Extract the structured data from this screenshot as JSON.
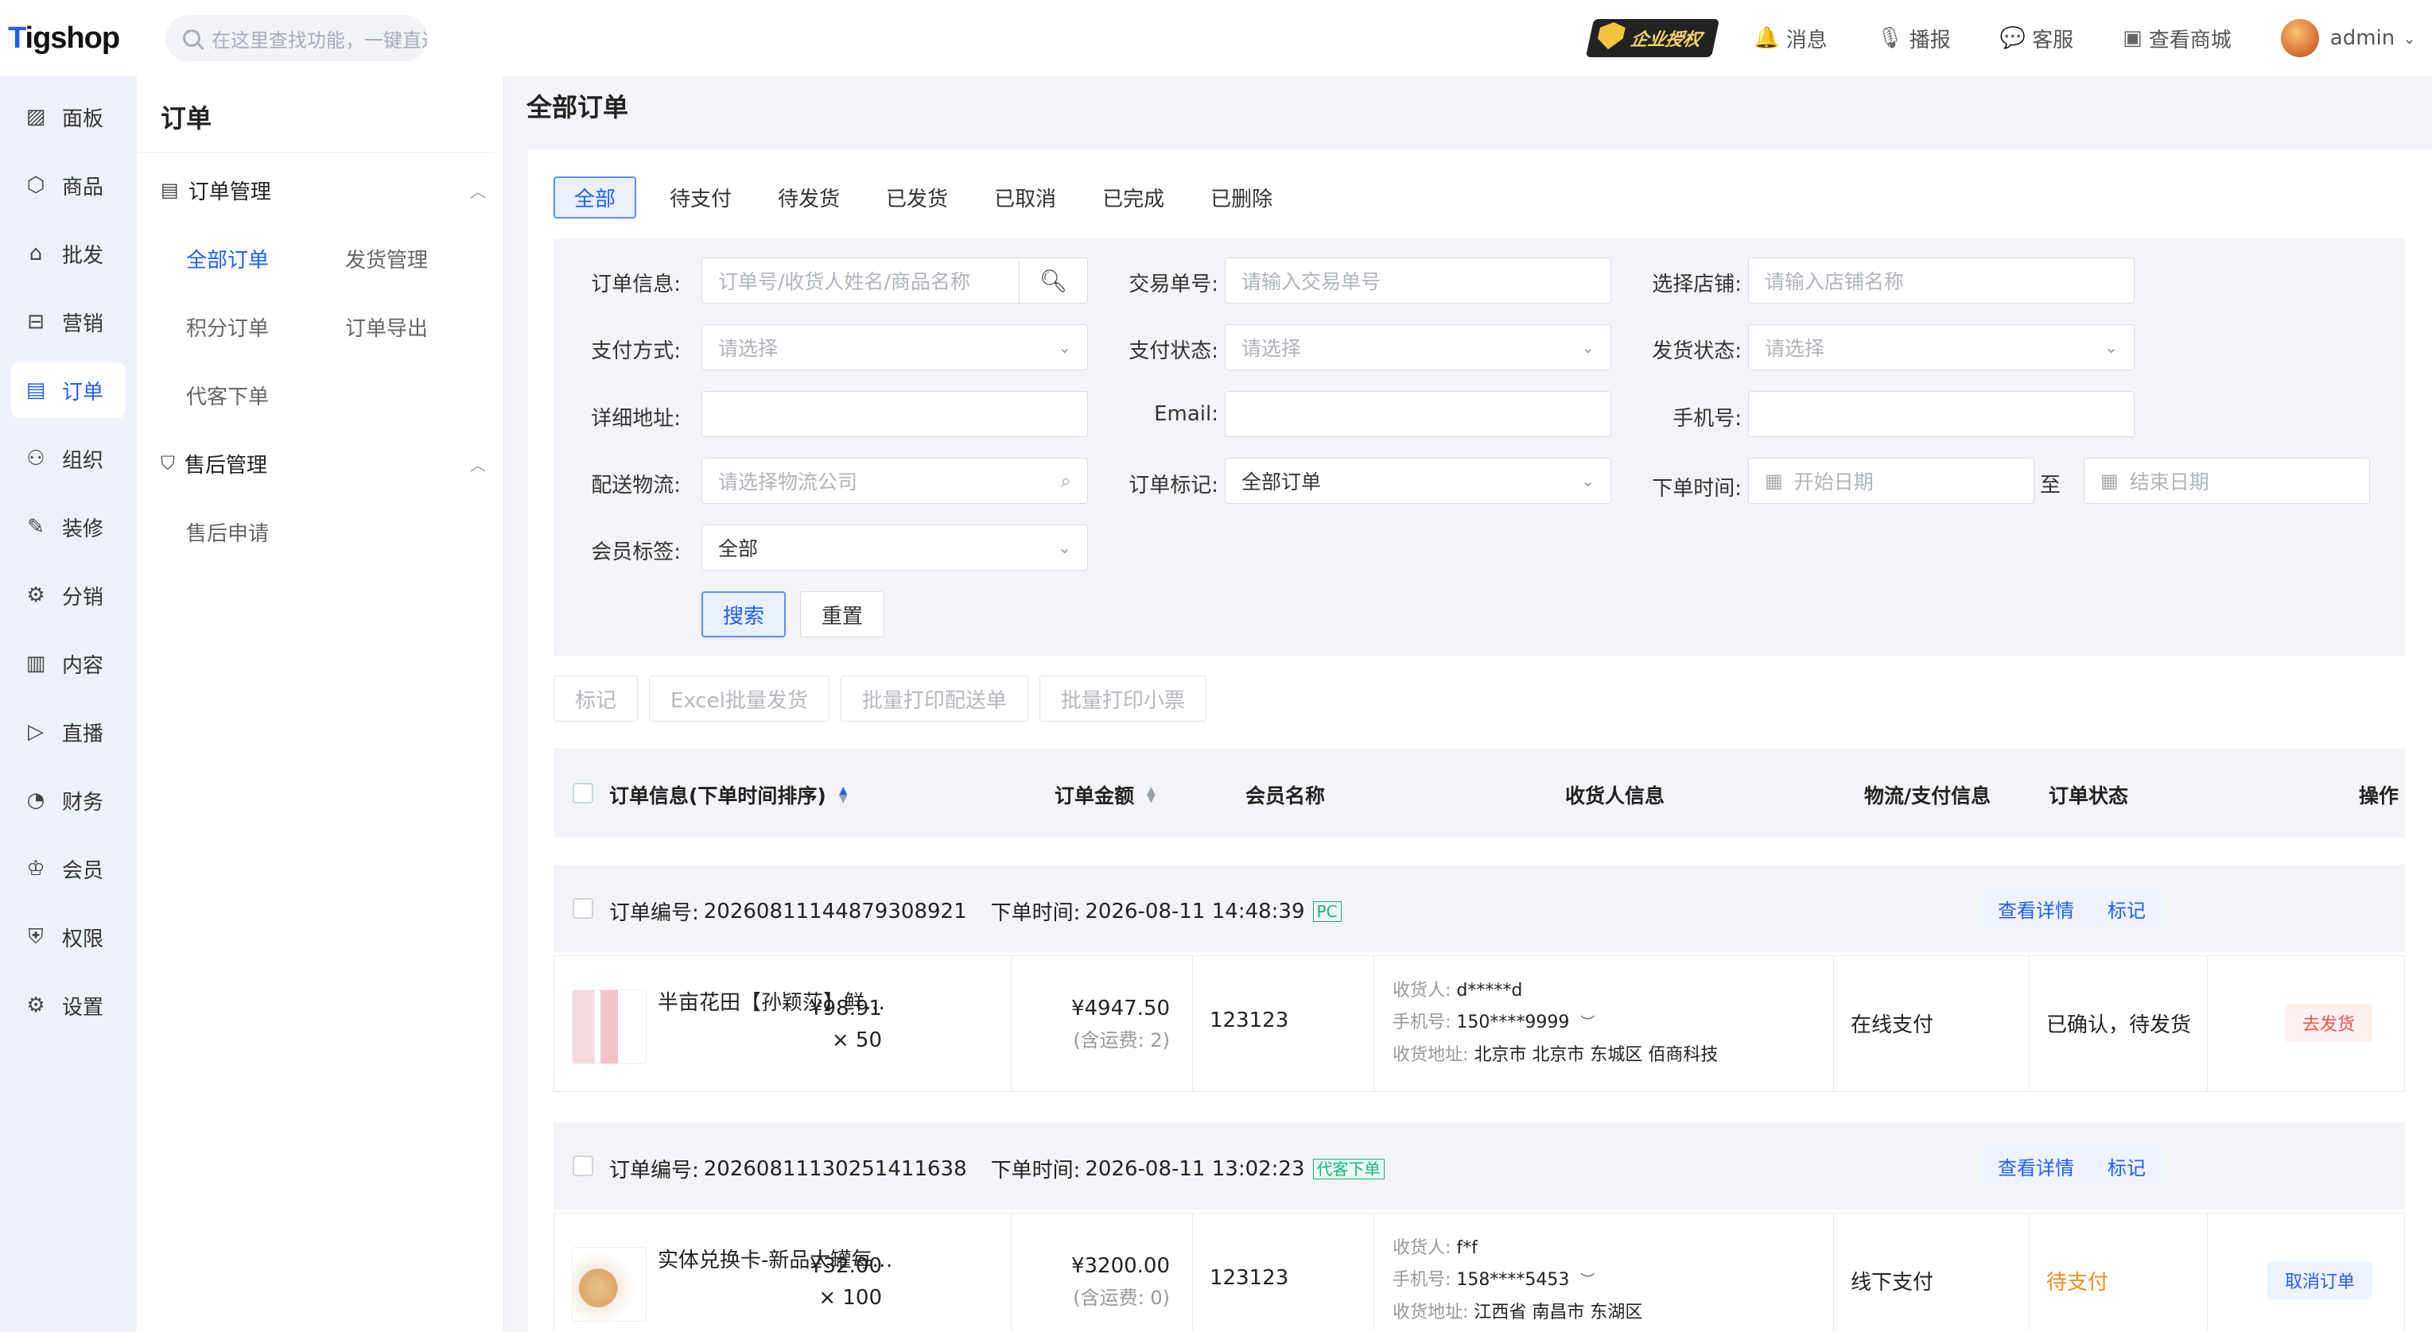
{
  "app": {
    "logo": "Tigshop",
    "logo_first": "T",
    "logo_rest": "igshop"
  },
  "search": {
    "placeholder": "在这里查找功能，一键直达"
  },
  "top": {
    "badge": "企业授权",
    "links": [
      {
        "icon": "bell-icon",
        "label": "消息"
      },
      {
        "icon": "broadcast-icon",
        "label": "播报"
      },
      {
        "icon": "chat-icon",
        "label": "客服"
      },
      {
        "icon": "shop-icon",
        "label": "查看商城"
      }
    ],
    "user": "admin"
  },
  "leftnav": [
    {
      "label": "面板",
      "icon": "dashboard-icon"
    },
    {
      "label": "商品",
      "icon": "box-icon"
    },
    {
      "label": "批发",
      "icon": "store-icon"
    },
    {
      "label": "营销",
      "icon": "marketing-icon"
    },
    {
      "label": "订单",
      "icon": "order-icon",
      "active": true
    },
    {
      "label": "组织",
      "icon": "org-icon"
    },
    {
      "label": "装修",
      "icon": "decorate-icon"
    },
    {
      "label": "分销",
      "icon": "distribution-icon"
    },
    {
      "label": "内容",
      "icon": "content-icon"
    },
    {
      "label": "直播",
      "icon": "live-icon"
    },
    {
      "label": "财务",
      "icon": "finance-icon"
    },
    {
      "label": "会员",
      "icon": "member-icon"
    },
    {
      "label": "权限",
      "icon": "permission-icon"
    },
    {
      "label": "设置",
      "icon": "settings-icon"
    }
  ],
  "subnav": {
    "title": "订单",
    "groups": [
      {
        "title": "订单管理",
        "items": [
          "全部订单",
          "发货管理",
          "积分订单",
          "订单导出",
          "代客下单"
        ]
      },
      {
        "title": "售后管理",
        "items": [
          "售后申请"
        ]
      }
    ]
  },
  "page": {
    "title": "全部订单"
  },
  "tabs": [
    "全部",
    "待支付",
    "待发货",
    "已发货",
    "已取消",
    "已完成",
    "已删除"
  ],
  "filters": {
    "order_info": {
      "label": "订单信息:",
      "placeholder": "订单号/收货人姓名/商品名称"
    },
    "trade_no": {
      "label": "交易单号:",
      "placeholder": "请输入交易单号"
    },
    "shop": {
      "label": "选择店铺:",
      "placeholder": "请输入店铺名称"
    },
    "pay_method": {
      "label": "支付方式:",
      "placeholder": "请选择"
    },
    "pay_status": {
      "label": "支付状态:",
      "placeholder": "请选择"
    },
    "ship_status": {
      "label": "发货状态:",
      "placeholder": "请选择"
    },
    "address": {
      "label": "详细地址:",
      "value": ""
    },
    "email": {
      "label": "Email:",
      "value": ""
    },
    "phone": {
      "label": "手机号:",
      "value": ""
    },
    "logistics": {
      "label": "配送物流:",
      "placeholder": "请选择物流公司"
    },
    "order_mark": {
      "label": "订单标记:",
      "value": "全部订单"
    },
    "order_time": {
      "label": "下单时间:",
      "start": "开始日期",
      "sep": "至",
      "end": "结束日期"
    },
    "member_tag": {
      "label": "会员标签:",
      "value": "全部"
    },
    "search_btn": "搜索",
    "reset_btn": "重置"
  },
  "batch": [
    "标记",
    "Excel批量发货",
    "批量打印配送单",
    "批量打印小票"
  ],
  "table_head": {
    "order_info": "订单信息(下单时间排序)",
    "amount": "订单金额",
    "member": "会员名称",
    "receiver": "收货人信息",
    "logistics": "物流/支付信息",
    "status": "订单状态",
    "op": "操作"
  },
  "orders": [
    {
      "no_label": "订单编号:",
      "no": "20260811144879308921",
      "time_label": "下单时间:",
      "time": "2026-08-11 14:48:39",
      "tag": "PC",
      "detail_btn": "查看详情",
      "mark_btn": "标记",
      "product": "半亩花田【孙颖莎】鲜花沐浴露",
      "price": "¥98.91",
      "qty": "× 50",
      "amount": "¥4947.50",
      "shipping": "(含运费: 2)",
      "member": "123123",
      "recv_name_k": "收货人:",
      "recv_name": "d*****d",
      "recv_phone_k": "手机号:",
      "recv_phone": "150****9999",
      "recv_addr_k": "收货地址:",
      "recv_addr": "北京市 北京市 东城区 佰商科技",
      "pay": "在线支付",
      "status": "已确认，待发货",
      "op": "去发货"
    },
    {
      "no_label": "订单编号:",
      "no": "20260811130251411638",
      "time_label": "下单时间:",
      "time": "2026-08-11 13:02:23",
      "tag": "代客下单",
      "detail_btn": "查看详情",
      "mark_btn": "标记",
      "product": "实体兑换卡-新品大罐每日坚果",
      "price": "¥32.00",
      "qty": "× 100",
      "amount": "¥3200.00",
      "shipping": "(含运费: 0)",
      "member": "123123",
      "recv_name_k": "收货人:",
      "recv_name": "f*f",
      "recv_phone_k": "手机号:",
      "recv_phone": "158****5453",
      "recv_addr_k": "收货地址:",
      "recv_addr": "江西省 南昌市 东湖区",
      "pay": "线下支付",
      "status": "待支付",
      "op": "取消订单"
    }
  ],
  "colors": {
    "accent": "#1f5fff",
    "danger": "#f0524f",
    "warning": "#f08c1e",
    "success": "#19b17b"
  }
}
